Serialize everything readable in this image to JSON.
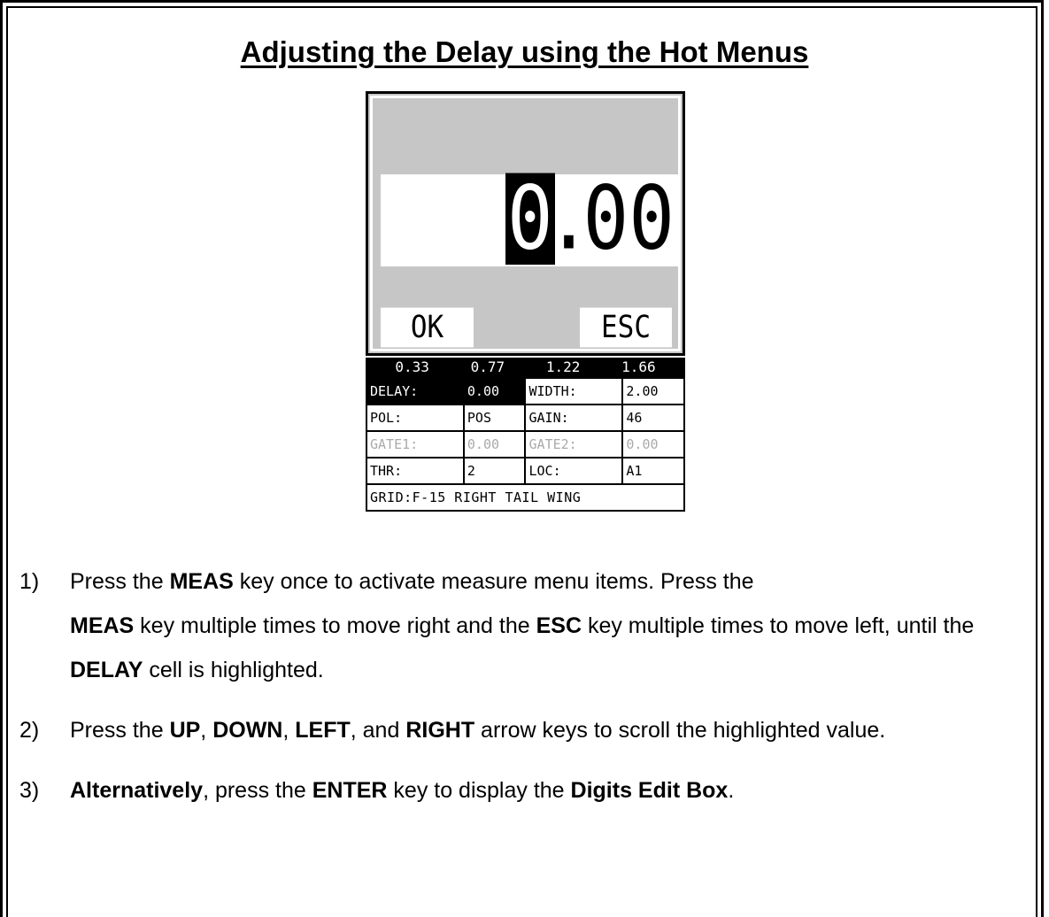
{
  "title": "Adjusting the Delay using the Hot Menus",
  "screen": {
    "digit_cursor": "0",
    "digit_dot": ".",
    "digit_rest": "00",
    "ok_label": "OK",
    "esc_label": "ESC",
    "scale": [
      "0.33",
      "0.77",
      "1.22",
      "1.66"
    ],
    "rows": [
      {
        "l1": "DELAY:",
        "v1": "0.00",
        "l2": "WIDTH:",
        "v2": "2.00"
      },
      {
        "l1": "POL:",
        "v1": "POS",
        "l2": "GAIN:",
        "v2": "46"
      },
      {
        "l1": "GATE1:",
        "v1": "0.00",
        "l2": "GATE2:",
        "v2": "0.00"
      },
      {
        "l1": "THR:",
        "v1": "2",
        "l2": "LOC:",
        "v2": "A1"
      }
    ],
    "grid_label": "GRID:",
    "grid_value": "F-15 RIGHT TAIL WING"
  },
  "steps": [
    {
      "num": "1)",
      "parts": [
        "Press the ",
        "MEAS",
        " key once to activate measure menu items.  Press the ",
        "MEAS",
        " key multiple times to move right and the ",
        "ESC",
        " key multiple times to move left, until the ",
        "DELAY",
        " cell is highlighted."
      ]
    },
    {
      "num": "2)",
      "parts": [
        "Press the ",
        "UP",
        ", ",
        "DOWN",
        ", ",
        "LEFT",
        ", and ",
        "RIGHT",
        " arrow keys to scroll the highlighted value."
      ]
    },
    {
      "num": "3)",
      "parts": [
        "",
        "Alternatively",
        ", press the ",
        "ENTER",
        " key to display the ",
        "Digits Edit Box",
        "."
      ]
    }
  ]
}
